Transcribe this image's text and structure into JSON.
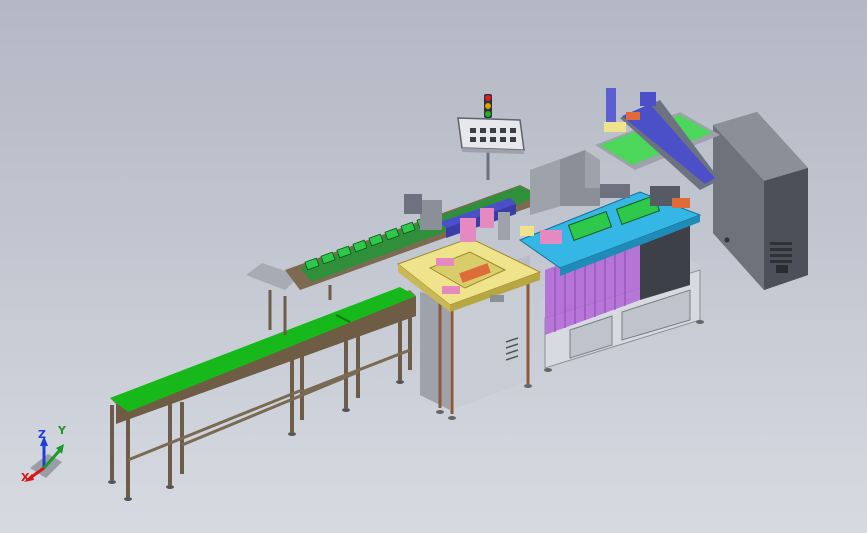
{
  "triad": {
    "z_label": "Z",
    "y_label": "Y",
    "x_label": "X",
    "z_color": "#1f3fd8",
    "y_color": "#1b9a2a",
    "x_color": "#d41818"
  },
  "palette": {
    "background_top": "#b3b8c4",
    "background_bottom": "#d7dae1",
    "belt_green": "#17b81a",
    "frame_bronze": "#7d6a50",
    "cabinet_grey": "#a9aeb8",
    "cabinet_panel": "#c8ccd4",
    "plate_yellow": "#efe48c",
    "plate_cyan": "#35b7e6",
    "purple_guard": "#b36bd6",
    "pink_block": "#e58ac0",
    "rail_blue": "#4b4fc8",
    "tower_light_red": "#e02020",
    "tower_light_amber": "#e0a000",
    "tower_light_green": "#20b020",
    "control_box_dark": "#5f646c"
  }
}
